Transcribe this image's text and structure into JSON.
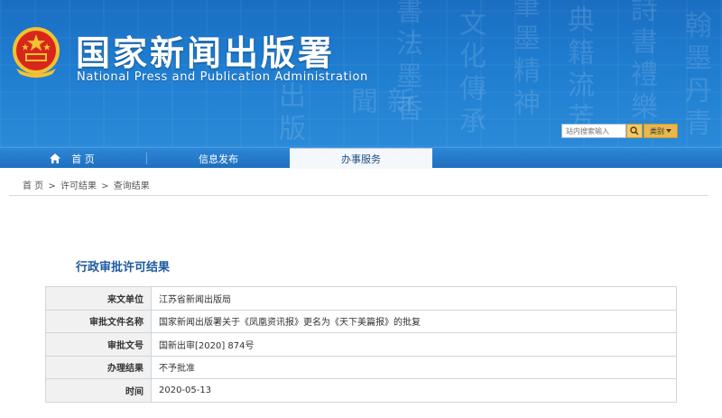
{
  "site": {
    "title": "国家新闻出版署",
    "subtitle": "National  Press and Publication Administration"
  },
  "search": {
    "placeholder": "站内搜索输入",
    "category_label": "类别",
    "search_icon": "search-icon",
    "dropdown_icon": "chevron-down-icon"
  },
  "nav": {
    "home_icon": "home-icon",
    "items": [
      {
        "label": "首 页",
        "active": false
      },
      {
        "label": "信息发布",
        "active": false
      },
      {
        "label": "办事服务",
        "active": true
      }
    ]
  },
  "breadcrumb": [
    "首 页",
    ">",
    "许可结果",
    ">",
    "查询结果"
  ],
  "content": {
    "section_title": "行政审批许可结果",
    "rows": [
      {
        "key": "来文单位",
        "value": "江苏省新闻出版局"
      },
      {
        "key": "审批文件名称",
        "value": "国家新闻出版署关于《凤凰资讯报》更名为《天下美篇报》的批复"
      },
      {
        "key": "审批文号",
        "value": "国新出审[2020] 874号"
      },
      {
        "key": "办理结果",
        "value": "不予批准"
      },
      {
        "key": "时间",
        "value": "2020-05-13"
      }
    ]
  },
  "colors": {
    "header_blue": "#1f7dd0",
    "title_blue": "#1e5aa0",
    "accent_gold": "#e8b84f"
  }
}
